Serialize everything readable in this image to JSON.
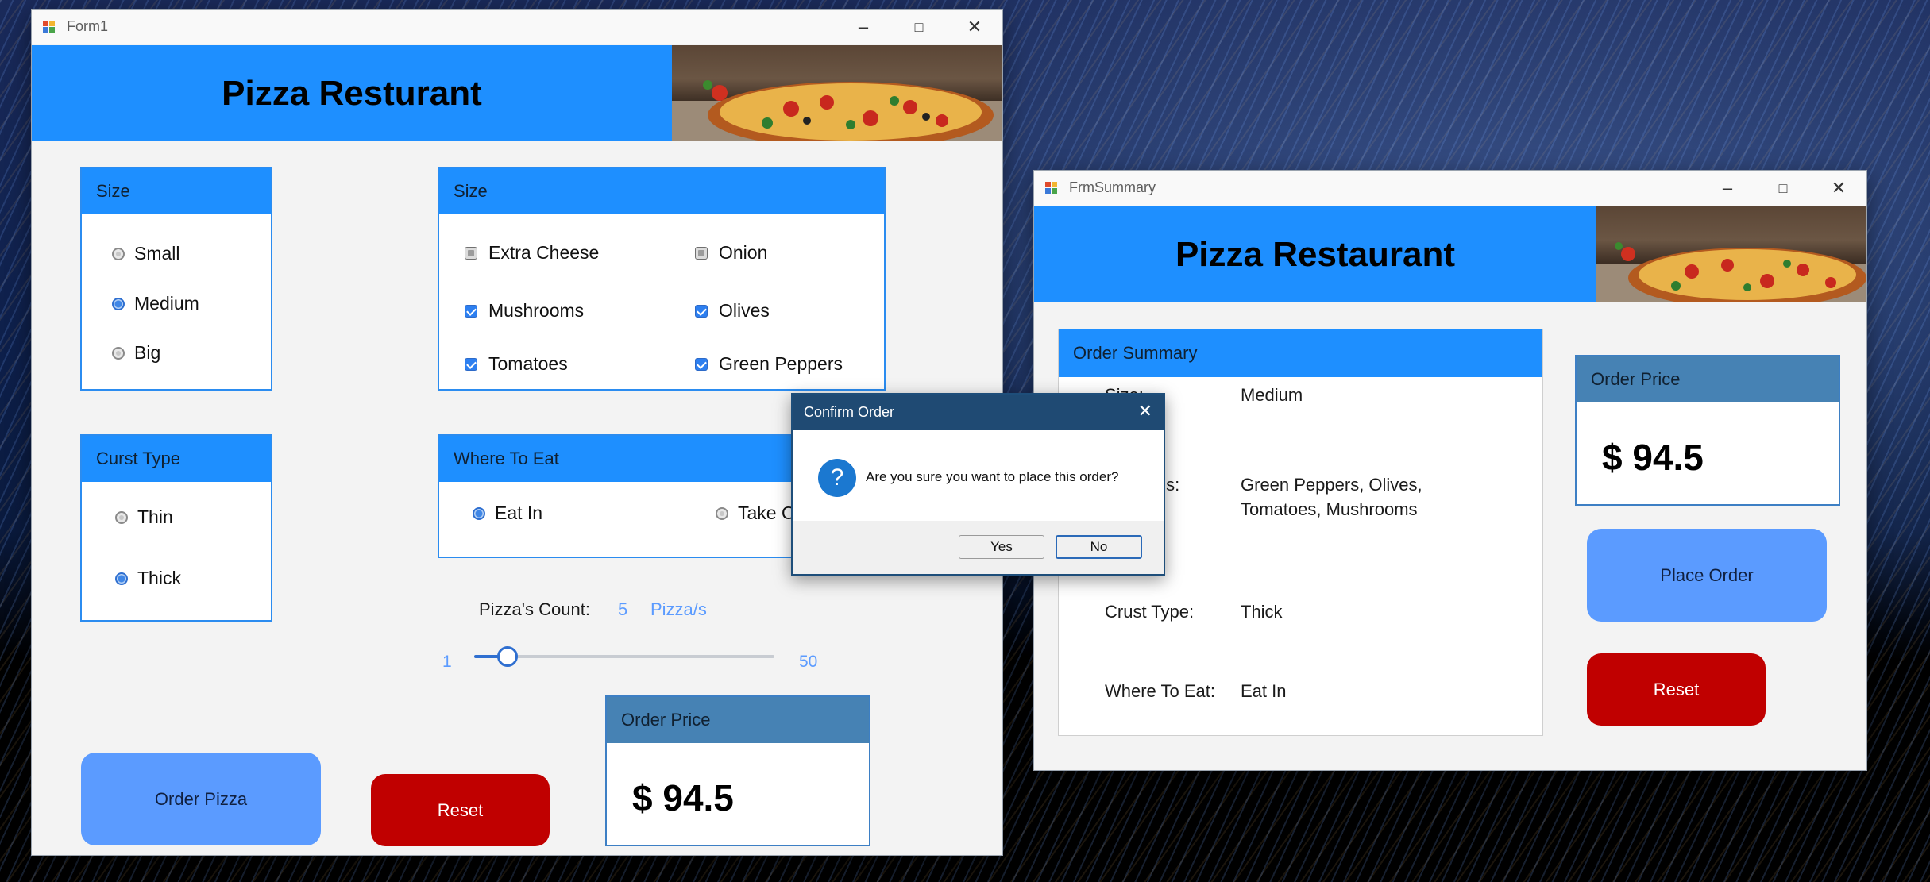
{
  "form1": {
    "window_title": "Form1",
    "banner_title": "Pizza Resturant",
    "size_group": {
      "header": "Size",
      "options": [
        {
          "label": "Small",
          "selected": false
        },
        {
          "label": "Medium",
          "selected": true
        },
        {
          "label": "Big",
          "selected": false
        }
      ]
    },
    "toppings_group": {
      "header": "Size",
      "items": [
        {
          "label": "Extra Cheese",
          "checked": false
        },
        {
          "label": "Onion",
          "checked": false
        },
        {
          "label": "Mushrooms",
          "checked": true
        },
        {
          "label": "Olives",
          "checked": true
        },
        {
          "label": "Tomatoes",
          "checked": true
        },
        {
          "label": "Green Peppers",
          "checked": true
        }
      ]
    },
    "crust_group": {
      "header": "Curst Type",
      "options": [
        {
          "label": "Thin",
          "selected": false
        },
        {
          "label": "Thick",
          "selected": true
        }
      ]
    },
    "where_group": {
      "header": "Where To Eat",
      "options": [
        {
          "label": "Eat In",
          "selected": true
        },
        {
          "label": "Take Out",
          "selected": false
        }
      ]
    },
    "count": {
      "label": "Pizza's Count:",
      "value": "5",
      "unit": "Pizza/s",
      "min_label": "1",
      "max_label": "50",
      "min": 1,
      "max": 50,
      "current": 5
    },
    "order_price": {
      "header": "Order Price",
      "value": "$ 94.5"
    },
    "order_button": "Order Pizza",
    "reset_button": "Reset"
  },
  "summary": {
    "window_title": "FrmSummary",
    "banner_title": "Pizza Restaurant",
    "order_summary": {
      "header": "Order Summary",
      "size_label": "Size:",
      "size_value": "Medium",
      "toppings_label": "Toppings:",
      "toppings_value_line1": "Green Peppers, Olives,",
      "toppings_value_line2": "Tomatoes, Mushrooms",
      "crust_label": "Crust Type:",
      "crust_value": "Thick",
      "where_label": "Where To Eat:",
      "where_value": "Eat In"
    },
    "order_price": {
      "header": "Order Price",
      "value": "$ 94.5"
    },
    "place_order_button": "Place Order",
    "reset_button": "Reset"
  },
  "dialog": {
    "title": "Confirm Order",
    "message": "Are you sure you want to place this order?",
    "yes_button": "Yes",
    "no_button": "No",
    "icon_glyph": "?"
  },
  "colors": {
    "banner_blue": "#1e8fff",
    "order_price_header": "#4682b4",
    "button_blue": "#5b9bff",
    "button_red": "#c00000",
    "dialog_title": "#1f4a73"
  }
}
